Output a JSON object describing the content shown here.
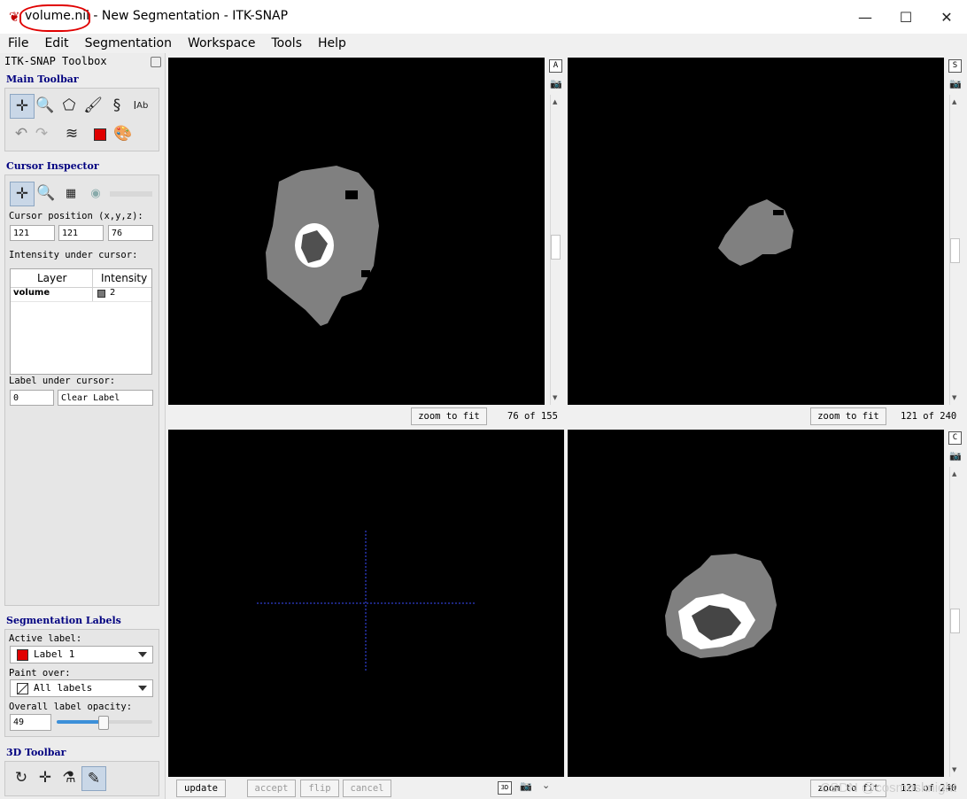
{
  "window": {
    "title_prefix": "volume.nii",
    "title_rest": " - New Segmentation - ITK-SNAP",
    "minimize_glyph": "—",
    "maximize_glyph": "☐",
    "close_glyph": "✕"
  },
  "menu": [
    "File",
    "Edit",
    "Segmentation",
    "Workspace",
    "Tools",
    "Help"
  ],
  "toolbox": {
    "title": "ITK-SNAP Toolbox",
    "main_toolbar_title": "Main Toolbar",
    "cursor_inspector_title": "Cursor Inspector",
    "cursor_position_label": "Cursor position (x,y,z):",
    "cursor_x": "121",
    "cursor_y": "121",
    "cursor_z": "76",
    "intensity_label": "Intensity under cursor:",
    "table_headers": [
      "Layer",
      "Intensity"
    ],
    "table_rows": [
      {
        "layer": "volume",
        "intensity": "2"
      }
    ],
    "label_under_cursor_label": "Label under cursor:",
    "label_under_cursor_id": "0",
    "label_under_cursor_name": "Clear Label",
    "seg_labels_title": "Segmentation Labels",
    "active_label_label": "Active label:",
    "active_label_value": "Label 1",
    "active_label_color": "#e00000",
    "paint_over_label": "Paint over:",
    "paint_over_value": "All labels",
    "opacity_label": "Overall label opacity:",
    "opacity_value": "49",
    "opacity_fraction": 0.49,
    "toolbar3d_title": "3D Toolbar"
  },
  "views": {
    "axial": {
      "zoom_label": "zoom to fit",
      "slice": "76 of 155",
      "badge": "A"
    },
    "sagittal": {
      "zoom_label": "zoom to fit",
      "slice": "121 of 240",
      "badge": "S"
    },
    "coronal": {
      "zoom_label": "zoom to fit",
      "slice": "121 of 240",
      "badge": "C"
    },
    "view3d": {
      "update": "update",
      "accept": "accept",
      "flip": "flip",
      "cancel": "cancel",
      "badge": "3D"
    }
  },
  "watermark": "CSDN @cosmosknight"
}
